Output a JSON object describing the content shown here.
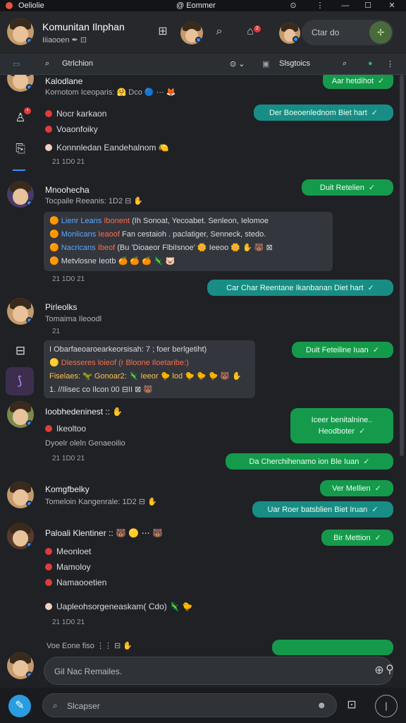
{
  "titlebar": {
    "app_name": "Oeliolie",
    "window_title": "@ Eommer",
    "controls": [
      "⊙",
      "⋮",
      "—",
      "☐",
      "✕"
    ]
  },
  "header": {
    "title": "Komunitan Ilnphan",
    "subtitle": "Iiiaooen ✒ ⊡",
    "search_placeholder": "Ctar do",
    "badge_count": "2"
  },
  "toolbar": {
    "search_label": "Gtrlchion",
    "filter_label": "⊙ ⌄",
    "channel_label": "Slsgtoics",
    "top_bubble": "Aar hetdihot"
  },
  "messages": [
    {
      "name": "Kalodlane",
      "meta": "Kornotom Iceoparis: 🤗 Dco 🔵 ⋯ 🦊",
      "lines": [
        "Nocr karkaon",
        "Voaonfoiky",
        "Konnnledan Eandehalnom 🍋"
      ],
      "time": "21  1D0  21"
    },
    {
      "name": "Mnoohecha",
      "meta": "Tocpaile Reeanis: 1D2 ⊟ ✋",
      "card": [
        {
          "a": "Lienr Leans",
          "b": "Ibonent",
          "c": "(Ih Sonoat, Yecoabet. Senleon, Ielomoe"
        },
        {
          "a": "Monlicans",
          "b": "Ieaoof",
          "c": "Fan cestaioh . paclatiger, Senneck, stedo."
        },
        {
          "a": "Nacricans",
          "b": "Ibeof",
          "c": "(Bu 'Dioaeor FlbiIsnoe' 🌼 Ieeoo 🌼 ✋ 🐻 ⊠"
        },
        {
          "a": "Metvlosne",
          "b": "Ieotb",
          "c": "🍊 🍊 🍊 🦎 🐷"
        }
      ],
      "time": "21  1D0  21"
    },
    {
      "name": "Pirleolks",
      "meta": "Tomaima Ileoodl",
      "time": "21"
    },
    {
      "name": "",
      "card2": [
        "I Obarfaeoaroearkeorsisah: 7 ; foer berlgetiht)",
        "🟡 Dlesseres  loieof  (r  Bloone  Iloetaribe:)",
        "Fiselaes: 🦖 Gonoar2: 🦎 Ieeor 🐤 lod 🐤 🐤 🐤 🐻 ✋",
        "1. //Ilisec  co  Ilcon  00  ⊟II  ⊠  🐻"
      ]
    },
    {
      "name": "Ioobhedeninest :: ✋",
      "lines": [
        "Ikeoltoo"
      ],
      "meta2": "Dyoelr oleln Genaeoilio",
      "time": "21  1D0  21"
    },
    {
      "name": "Komgfbelky",
      "meta": "Tomeloin Kangenrale: 1D2 ⊟ ✋"
    },
    {
      "name": "Paloali Klentiner :: 🐻 🟡 ⋯ 🐻",
      "lines": [
        "Meonloet",
        "Mamoloy",
        "Namaooetien",
        "Uapleohsorgeneaskam( Cdo) 🦎 🐤"
      ],
      "time": "21  1D0  21",
      "meta2": "Voe Eone fiso  ⋮⋮  ⊟  ✋"
    }
  ],
  "bubbles": [
    {
      "text": "Der Boeoenlednom Biet hart",
      "tone": "teal"
    },
    {
      "text": "Duit Retelien",
      "tone": "green",
      "prefix": "3"
    },
    {
      "text": "Car Char Reentane Ikanbanan Diet hart",
      "tone": "teal"
    },
    {
      "text": "Duit Feteiline Iuan",
      "tone": "green",
      "prefix": "⋮"
    },
    {
      "text": "Iceer benitalnine.. Heodboter",
      "tone": "green",
      "prefix": "⋮ 🐤"
    },
    {
      "text": "Da Cherchihenamo ion Ble Iuan",
      "tone": "green"
    },
    {
      "text": "Ver Mellien",
      "tone": "green",
      "prefix": "3"
    },
    {
      "text": "Uar Roer batsblien Biet Iruan",
      "tone": "teal"
    },
    {
      "text": "Bir Mettion",
      "tone": "green",
      "prefix": "3"
    }
  ],
  "compose": {
    "placeholder": "Gil Nac Remailes."
  },
  "bottom": {
    "search_placeholder": "Slcapser"
  },
  "colors": {
    "accent": "#3b8cff",
    "teal": "#188d86",
    "green": "#159a4c",
    "alert": "#e23b3b"
  }
}
